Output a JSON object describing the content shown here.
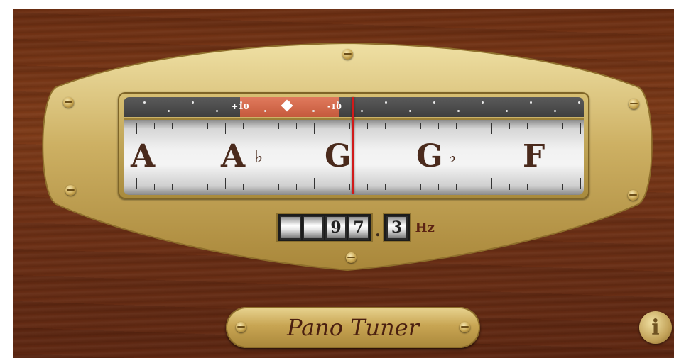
{
  "app": {
    "title": "Pano Tuner"
  },
  "cents": {
    "left_label": "+10",
    "right_label": "-10"
  },
  "notes": [
    {
      "letter": "A",
      "accidental": ""
    },
    {
      "letter": "A",
      "accidental": "♭"
    },
    {
      "letter": "G",
      "accidental": ""
    },
    {
      "letter": "G",
      "accidental": "♭"
    },
    {
      "letter": "F",
      "accidental": ""
    }
  ],
  "frequency": {
    "digits": [
      "",
      "",
      "9",
      "7"
    ],
    "decimal": "3",
    "separator": ".",
    "unit": "Hz"
  },
  "info_button": {
    "label": "i"
  },
  "colors": {
    "wood": "#6b2e12",
    "brass": "#c9a752",
    "needle": "#d11a1a",
    "cent_range": "#d9694a"
  }
}
